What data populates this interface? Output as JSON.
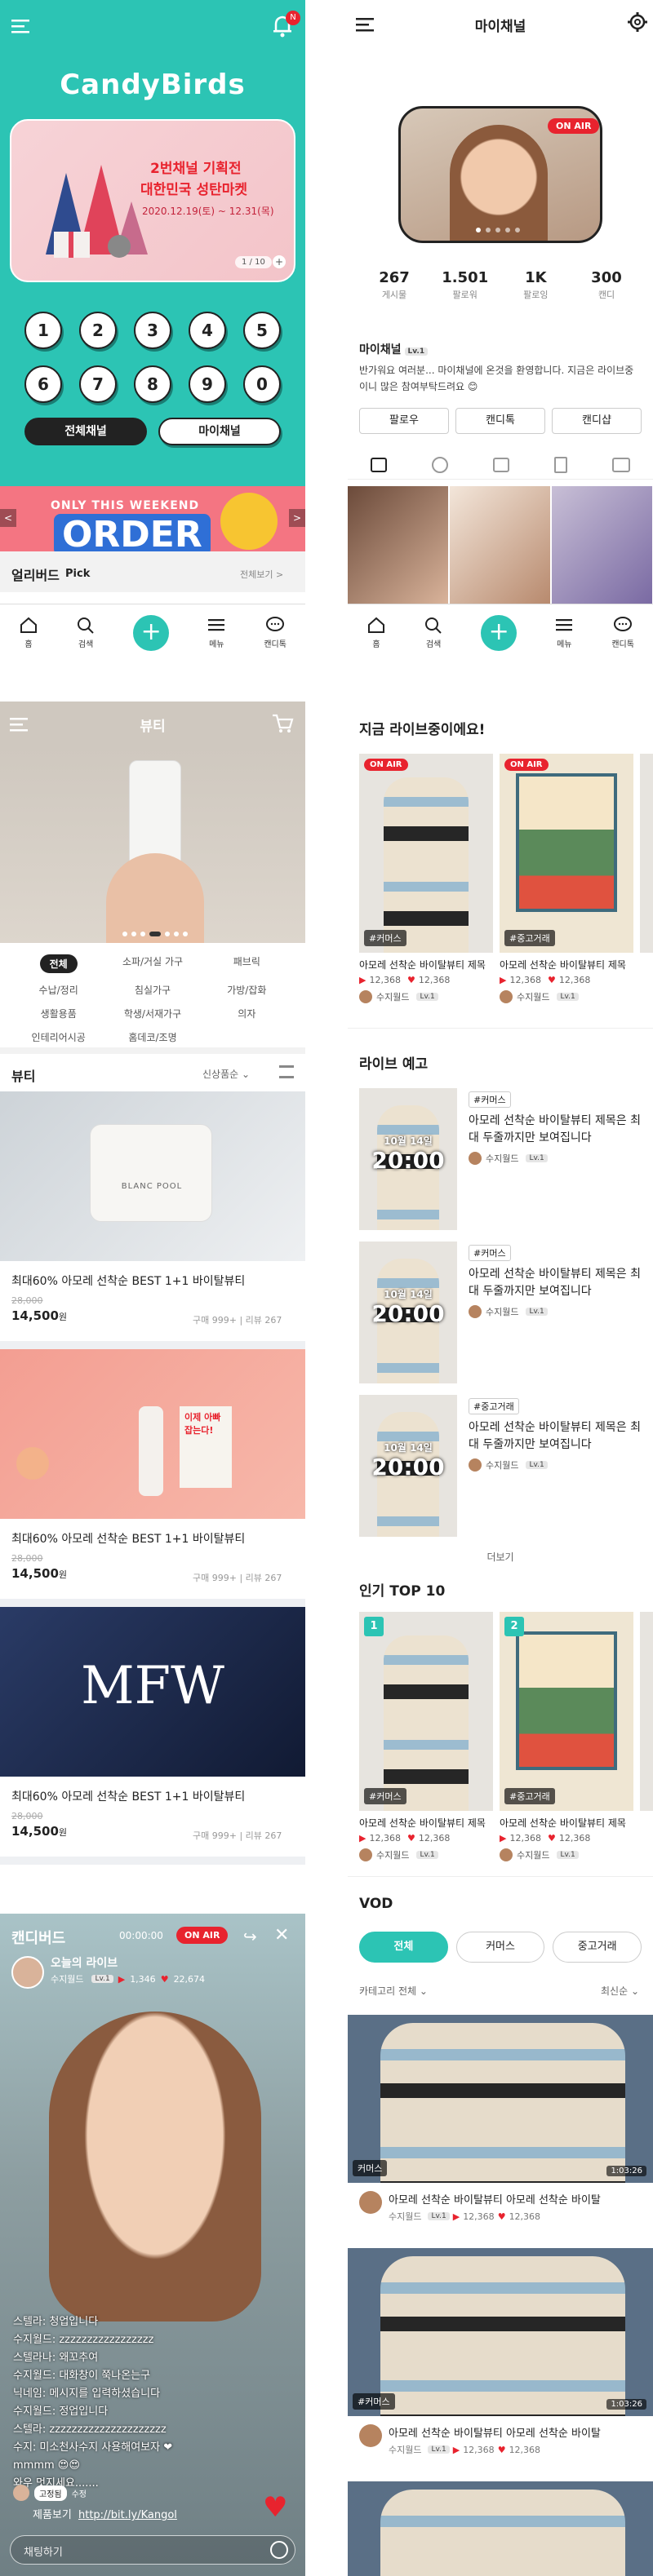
{
  "colors": {
    "teal": "#2cc4b4",
    "red": "#e8232e",
    "dark": "#222222"
  },
  "home": {
    "notif_badge": "N",
    "logo": "CandyBirds",
    "banner": {
      "line1": "2번채널 기획전",
      "line2": "대한민국 성탄마켓",
      "dates": "2020.12.19(토) ~ 12.31(목)",
      "pager": "1 / 10"
    },
    "channels": [
      "1",
      "2",
      "3",
      "4",
      "5",
      "6",
      "7",
      "8",
      "9",
      "0"
    ],
    "all_channel": "전체채널",
    "my_channel": "마이채널",
    "promo_text": "ONLY THIS WEEKEND",
    "promo_big": "ORDER",
    "earlybird": "얼리버드",
    "pick": "Pick",
    "view_all": "전체보기 >"
  },
  "nav": {
    "home": "홈",
    "search": "검색",
    "menu": "메뉴",
    "candytalk": "캔디톡"
  },
  "my": {
    "title": "마이채널",
    "on_air": "ON AIR",
    "stats": [
      {
        "value": "267",
        "label": "게시물"
      },
      {
        "value": "1.501",
        "label": "팔로워"
      },
      {
        "value": "1K",
        "label": "팔로잉"
      },
      {
        "value": "300",
        "label": "캔디"
      }
    ],
    "name": "마이채널",
    "level": "Lv.1",
    "bio": "반가워요 여러분... 마이채널에 온것을 환영합니다. 지금은 라이브중이니 많은 참여부탁드려요 😊",
    "buttons": [
      "팔로우",
      "캔디톡",
      "캔디샵"
    ]
  },
  "beauty": {
    "title": "뷰티",
    "categories": [
      "전체",
      "소파/거실 가구",
      "패브릭",
      "수납/정리",
      "침실가구",
      "가방/잡화",
      "생활용품",
      "학생/서재가구",
      "의자",
      "인테리어시공",
      "홈데코/조명"
    ],
    "section": "뷰티",
    "sort": "신상품순",
    "products": [
      {
        "title": "최대60% 아모레 선착순 BEST 1+1 바이탈뷰티",
        "old_price": "28,000",
        "price": "14,500",
        "unit": "원",
        "meta": "구매 999+ | 리뷰 267",
        "jar_label": "BLANC POOL"
      },
      {
        "title": "최대60% 아모레 선착순 BEST 1+1 바이탈뷰티",
        "old_price": "28,000",
        "price": "14,500",
        "unit": "원",
        "meta": "구매 999+ | 리뷰 267",
        "box_text": "이제 아빠 잡는다!"
      },
      {
        "title": "최대60% 아모레 선착순 BEST 1+1 바이탈뷰티",
        "old_price": "28,000",
        "price": "14,500",
        "unit": "원",
        "meta": "구매 999+ | 리뷰 267",
        "logo": "MFW"
      }
    ]
  },
  "live": {
    "section_title": "지금 라이브중이에요!",
    "on_air": "ON AIR",
    "cards": [
      {
        "tag": "#커머스",
        "title": "아모레 선착순 바이탈뷰티 제목",
        "views": "12,368",
        "likes": "12,368",
        "seller": "수지월드",
        "level": "Lv.1"
      },
      {
        "tag": "#중고거래",
        "title": "아모레 선착순 바이탈뷰티 제목",
        "views": "12,368",
        "likes": "12,368",
        "seller": "수지월드",
        "level": "Lv.1"
      }
    ],
    "preview_title": "라이브 예고",
    "previews": [
      {
        "date": "10월 14일",
        "time": "20:00",
        "tag": "#커머스",
        "title": "아모레 선착순 바이탈뷰티 제목은 최대 두줄까지만 보여집니다",
        "seller": "수지월드",
        "level": "Lv.1"
      },
      {
        "date": "10월 14일",
        "time": "20:00",
        "tag": "#커머스",
        "title": "아모레 선착순 바이탈뷰티 제목은 최대 두줄까지만 보여집니다",
        "seller": "수지월드",
        "level": "Lv.1"
      },
      {
        "date": "10월 14일",
        "time": "20:00",
        "tag": "#중고거래",
        "title": "아모레 선착순 바이탈뷰티 제목은 최대 두줄까지만 보여집니다",
        "seller": "수지월드",
        "level": "Lv.1"
      }
    ],
    "more": "더보기",
    "top_title": "인기 TOP 10",
    "top": [
      {
        "rank": "1",
        "tag": "#커머스",
        "title": "아모레 선착순 바이탈뷰티 제목",
        "views": "12,368",
        "likes": "12,368",
        "seller": "수지월드",
        "level": "Lv.1"
      },
      {
        "rank": "2",
        "tag": "#중고거래",
        "title": "아모레 선착순 바이탈뷰티 제목",
        "views": "12,368",
        "likes": "12,368",
        "seller": "수지월드",
        "level": "Lv.1"
      }
    ],
    "vod_title": "VOD",
    "vod_tabs": [
      "전체",
      "커머스",
      "중고거래"
    ],
    "vod_filter": "카테고리 전체",
    "vod_sort": "최신순",
    "vods": [
      {
        "tag": "커머스",
        "duration": "1:03:26",
        "title": "아모레 선착순 바이탈뷰티 아모레 선착순 바이탈",
        "seller": "수지월드",
        "level": "Lv.1",
        "views": "12,368",
        "likes": "12,368"
      },
      {
        "tag": "#커머스",
        "duration": "1:03:26",
        "title": "아모레 선착순 바이탈뷰티 아모레 선착순 바이탈",
        "seller": "수지월드",
        "level": "Lv.1",
        "views": "12,368",
        "likes": "12,368"
      }
    ]
  },
  "player": {
    "title": "캔디버드",
    "timer": "00:00:00",
    "on_air": "ON AIR",
    "live_name": "오늘의 라이브",
    "host": "수지월드",
    "level": "Lv.1",
    "views": "1,346",
    "likes": "22,674",
    "chat": [
      "스텔라: 청업입니다",
      "수지월드: zzzzzzzzzzzzzzzzz",
      "스텔라나: 왜꼬추여",
      "수지월드: 대화창이 쭉나온는구",
      "닉네임: 메시지를 입력하셨습니다",
      "수지월드: 정업입니다",
      "스텔라: zzzzzzzzzzzzzzzzzzzzz",
      "수지: 미소천사수지 사용해여보자 ❤",
      "mmmm 😍😍",
      "와우 멋지세요......."
    ],
    "badge1": "고정됨",
    "badge2": "수정",
    "link_label": "제품보기",
    "link": "http://bit.ly/Kangol",
    "input_placeholder": "채팅하기"
  }
}
